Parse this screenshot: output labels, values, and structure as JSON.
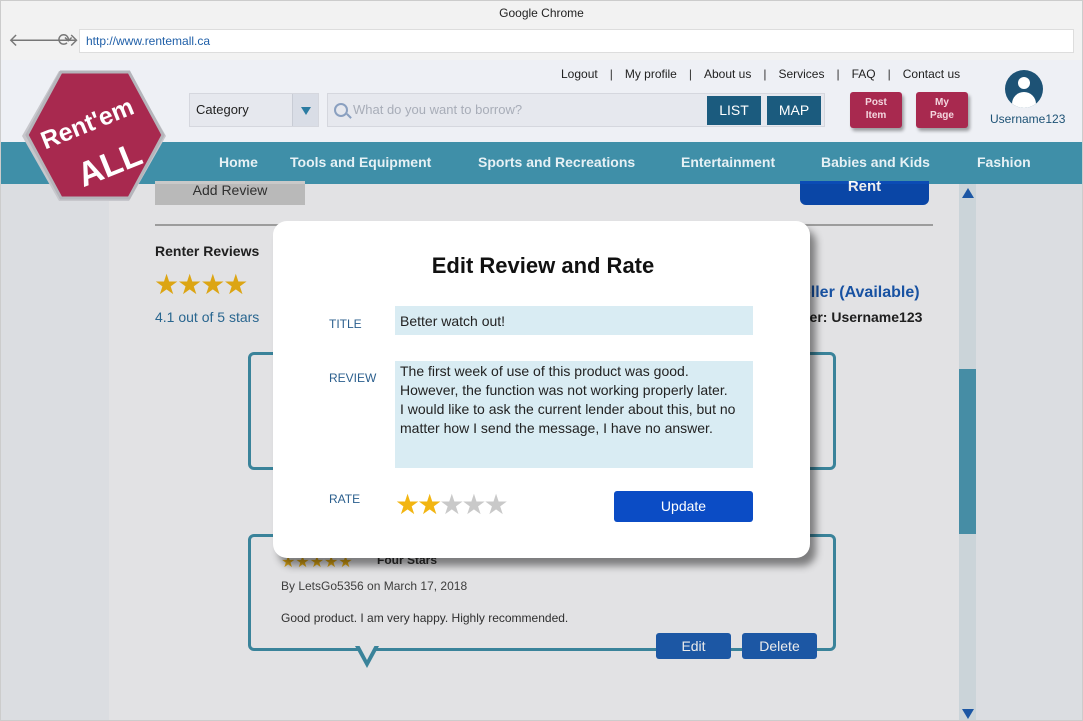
{
  "browser": {
    "window_title": "Google Chrome",
    "url": "http://www.rentemall.ca",
    "back_glyph": "🡐",
    "forward_glyph": "🡒",
    "reload_glyph": "⟳"
  },
  "logo": {
    "line1": "Rent'em",
    "line2": "ALL",
    "color": "#a8294f"
  },
  "header": {
    "top_links": [
      "Logout",
      "My profile",
      "About us",
      "Services",
      "FAQ",
      "Contact us"
    ],
    "category": "Category",
    "search_placeholder": "What do you want to borrow?",
    "list_label": "LIST",
    "map_label": "MAP",
    "post_item_line1": "Post",
    "post_item_line2": "Item",
    "my_page_line1": "My",
    "my_page_line2": "Page",
    "username": "Username123"
  },
  "nav": [
    "Home",
    "Tools and Equipment",
    "Sports and Recreations",
    "Entertainment",
    "Babies and Kids",
    "Fashion"
  ],
  "page": {
    "add_review": "Add Review",
    "rent": "Rent",
    "renter_reviews": "Renter Reviews",
    "bg_stars": "★★★★",
    "rating_text": "4.1 out of 5 stars",
    "product_fragment": "oller (Available)",
    "lender_fragment": "der: Username123",
    "review2": {
      "stars": "★★★★★",
      "subtitle": "Four Stars",
      "by": "By LetsGo5356 on March 17, 2018",
      "text": "Good product. I am very happy. Highly recommended.",
      "edit": "Edit",
      "delete": "Delete"
    }
  },
  "modal": {
    "title": "Edit Review and Rate",
    "title_label": "TITLE",
    "title_value": "Better watch out!",
    "review_label": "REVIEW",
    "review_value": "The first week of use of this product was good.\nHowever, the function was not working properly later.\nI would like to ask the current lender about this, but no matter how I send the message, I have no answer.",
    "rate_label": "RATE",
    "rating": 2,
    "max_rating": 5,
    "star_glyph": "★",
    "star_on_color": "#f2b512",
    "star_off_color": "#c9c9c9",
    "update": "Update"
  }
}
